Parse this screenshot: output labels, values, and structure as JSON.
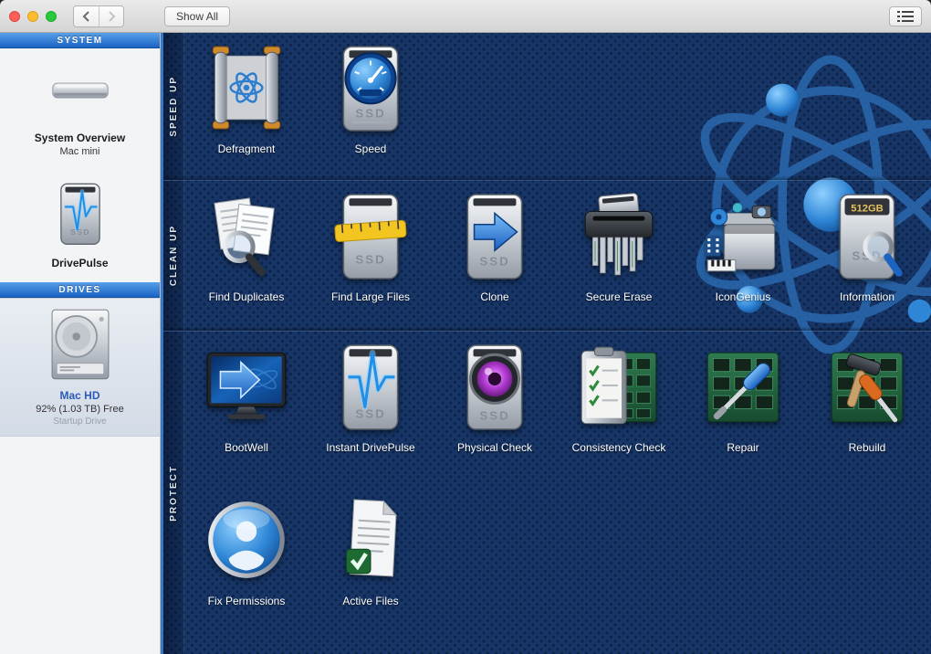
{
  "window": {
    "toolbar": {
      "show_all_label": "Show All"
    },
    "traffic_lights": [
      "close",
      "minimize",
      "zoom"
    ]
  },
  "sidebar": {
    "sections": [
      {
        "header": "SYSTEM",
        "items": [
          {
            "icon": "mac-mini-icon",
            "title": "System Overview",
            "subtitle": "Mac mini"
          },
          {
            "icon": "drivepulse-icon",
            "title": "DrivePulse"
          }
        ]
      },
      {
        "header": "DRIVES",
        "items": [
          {
            "icon": "hard-drive-icon",
            "title": "Mac HD",
            "subtitle": "92% (1.03 TB) Free",
            "note": "Startup Drive",
            "selected": true
          }
        ]
      }
    ]
  },
  "main": {
    "sections": [
      {
        "label": "SPEED UP",
        "tools": [
          {
            "icon": "defragment-icon",
            "name": "Defragment"
          },
          {
            "icon": "speed-icon",
            "name": "Speed"
          }
        ]
      },
      {
        "label": "CLEAN UP",
        "tools": [
          {
            "icon": "find-duplicates-icon",
            "name": "Find Duplicates"
          },
          {
            "icon": "find-large-files-icon",
            "name": "Find Large Files"
          },
          {
            "icon": "clone-icon",
            "name": "Clone"
          },
          {
            "icon": "secure-erase-icon",
            "name": "Secure Erase"
          },
          {
            "icon": "icongenius-icon",
            "name": "IconGenius"
          },
          {
            "icon": "information-icon",
            "name": "Information"
          }
        ]
      },
      {
        "label": "PROTECT",
        "tools": [
          {
            "icon": "bootwell-icon",
            "name": "BootWell"
          },
          {
            "icon": "instant-drivepulse-icon",
            "name": "Instant DrivePulse"
          },
          {
            "icon": "physical-check-icon",
            "name": "Physical Check"
          },
          {
            "icon": "consistency-check-icon",
            "name": "Consistency Check"
          },
          {
            "icon": "repair-icon",
            "name": "Repair"
          },
          {
            "icon": "rebuild-icon",
            "name": "Rebuild"
          },
          {
            "icon": "fix-permissions-icon",
            "name": "Fix Permissions"
          },
          {
            "icon": "active-files-icon",
            "name": "Active Files"
          }
        ]
      }
    ]
  },
  "icon_texts": {
    "ssd": "SSD",
    "capacity": "512GB"
  },
  "colors": {
    "main_background": "#173566",
    "section_header_top": "#58a0e8",
    "section_header_bottom": "#1a63c4",
    "selected_item_background": "#dde3ec",
    "selected_title": "#2a5cb8",
    "tile_label": "#ffffff",
    "accent_blue": "#2f86d6"
  }
}
